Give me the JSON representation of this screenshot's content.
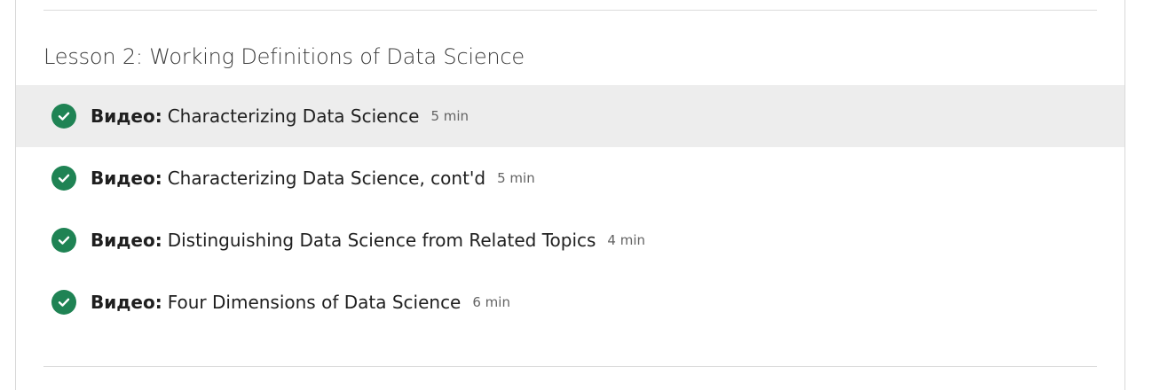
{
  "lesson": {
    "title": "Lesson 2: Working Definitions of Data Science"
  },
  "icons": {
    "completed": "check-circle-icon",
    "completed_color": "#1f8354"
  },
  "items": [
    {
      "kind": "Видео:",
      "title": "Characterizing Data Science",
      "duration": "5 min",
      "status": "completed",
      "highlighted": true
    },
    {
      "kind": "Видео:",
      "title": "Characterizing Data Science, cont'd",
      "duration": "5 min",
      "status": "completed",
      "highlighted": false
    },
    {
      "kind": "Видео:",
      "title": "Distinguishing Data Science from Related Topics",
      "duration": "4 min",
      "status": "completed",
      "highlighted": false
    },
    {
      "kind": "Видео:",
      "title": "Four Dimensions of Data Science",
      "duration": "6 min",
      "status": "completed",
      "highlighted": false
    }
  ]
}
